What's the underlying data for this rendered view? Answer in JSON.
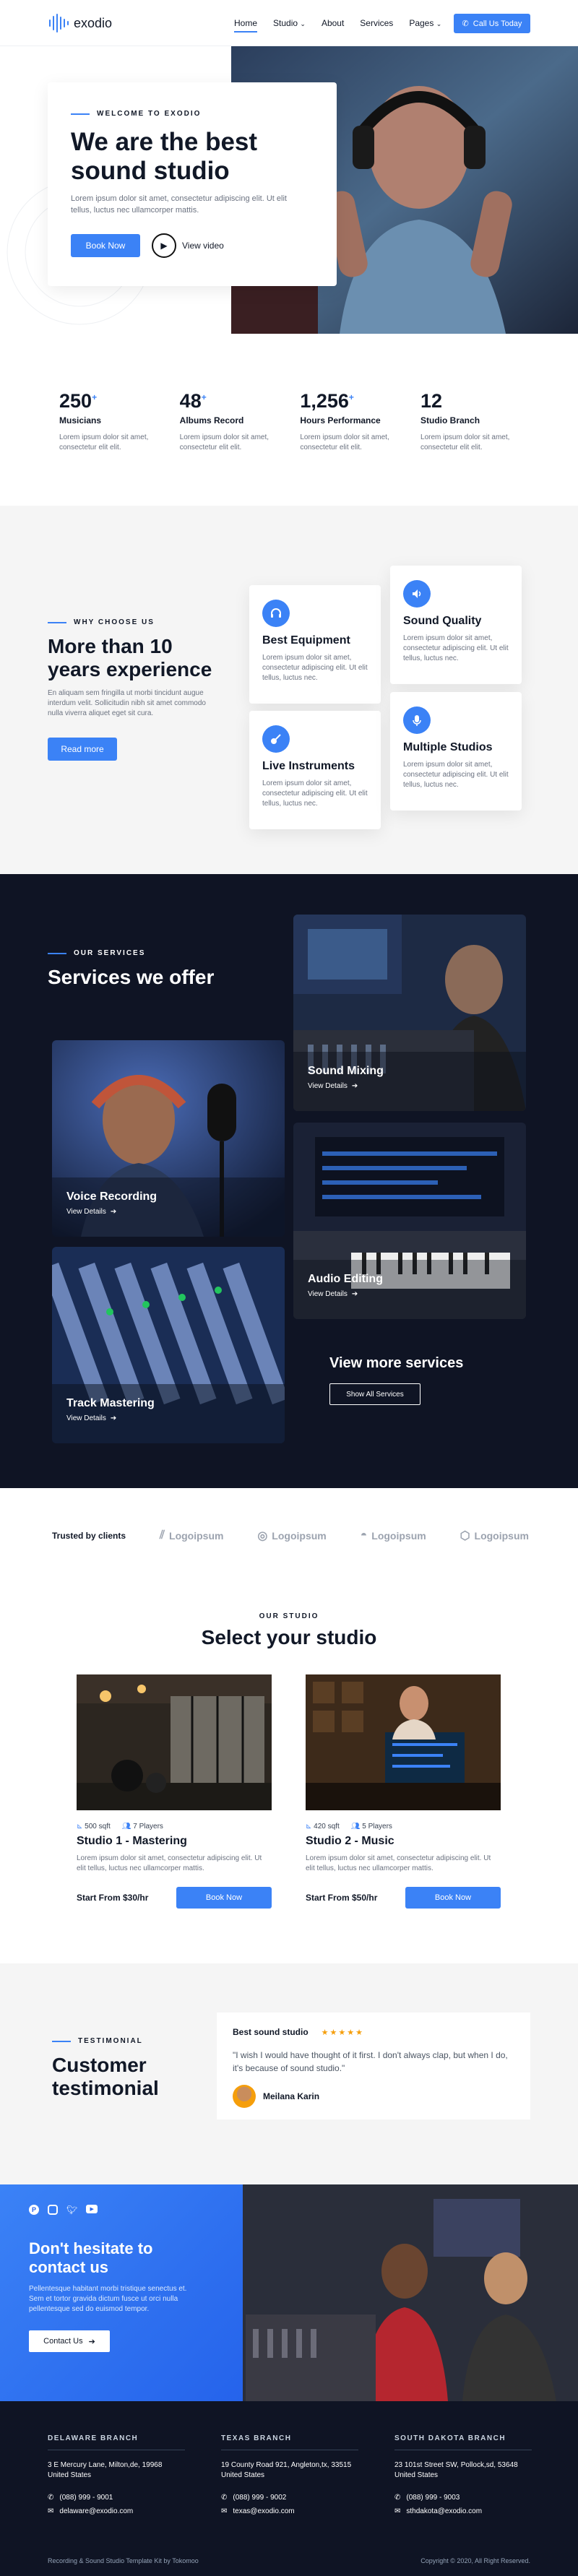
{
  "header": {
    "logo_text": "exodio",
    "nav": [
      "Home",
      "Studio",
      "About",
      "Services",
      "Pages"
    ],
    "cta": "Call Us Today"
  },
  "hero": {
    "eyebrow": "WELCOME TO EXODIO",
    "title_line1": "We are the best",
    "title_line2": "sound studio",
    "text": "Lorem ipsum dolor sit amet, consectetur adipiscing elit. Ut elit tellus, luctus nec ullamcorper mattis.",
    "primary_btn": "Book Now",
    "video_label": "View video"
  },
  "stats": [
    {
      "value": "250",
      "suffix": "+",
      "label": "Musicians",
      "text": "Lorem ipsum dolor sit amet, consectetur elit elit."
    },
    {
      "value": "48",
      "suffix": "+",
      "label": "Albums Record",
      "text": "Lorem ipsum dolor sit amet, consectetur elit elit."
    },
    {
      "value": "1,256",
      "suffix": "+",
      "label": "Hours Performance",
      "text": "Lorem ipsum dolor sit amet, consectetur elit elit."
    },
    {
      "value": "12",
      "suffix": "",
      "label": "Studio Branch",
      "text": "Lorem ipsum dolor sit amet, consectetur elit elit."
    }
  ],
  "why": {
    "eyebrow": "WHY CHOOSE US",
    "title_line1": "More than 10",
    "title_line2": "years experience",
    "text": "En aliquam sem fringilla ut morbi tincidunt augue interdum velit. Sollicitudin nibh sit amet commodo nulla viverra aliquet eget sit cura.",
    "btn": "Read more",
    "features": [
      {
        "title": "Best Equipment",
        "text": "Lorem ipsum dolor sit amet, consectetur adipiscing elit. Ut elit tellus, luctus nec.",
        "icon": "headphones-icon"
      },
      {
        "title": "Sound Quality",
        "text": "Lorem ipsum dolor sit amet, consectetur adipiscing elit. Ut elit tellus, luctus nec.",
        "icon": "speaker-icon"
      },
      {
        "title": "Live Instruments",
        "text": "Lorem ipsum dolor sit amet, consectetur adipiscing elit. Ut elit tellus, luctus nec.",
        "icon": "guitar-icon"
      },
      {
        "title": "Multiple Studios",
        "text": "Lorem ipsum dolor sit amet, consectetur adipiscing elit. Ut elit tellus, luctus nec.",
        "icon": "mic-icon"
      }
    ]
  },
  "services": {
    "eyebrow": "OUR SERVICES",
    "title": "Services we offer",
    "items": [
      {
        "title": "Sound Mixing",
        "link": "View Details"
      },
      {
        "title": "Voice Recording",
        "link": "View Details"
      },
      {
        "title": "Audio Editing",
        "link": "View Details"
      },
      {
        "title": "Track Mastering",
        "link": "View Details"
      }
    ],
    "more_title": "View more services",
    "more_btn": "Show All Services"
  },
  "clients": {
    "label": "Trusted by clients",
    "logos": [
      "Logoipsum",
      "Logoipsum",
      "Logoipsum",
      "Logoipsum"
    ]
  },
  "studio": {
    "eyebrow": "OUR STUDIO",
    "title": "Select your studio",
    "items": [
      {
        "size": "500 sqft",
        "players": "7 Players",
        "name": "Studio 1 - Mastering",
        "text": "Lorem ipsum dolor sit amet, consectetur adipiscing elit. Ut elit tellus, luctus nec ullamcorper mattis.",
        "price": "Start From $30/hr",
        "btn": "Book Now"
      },
      {
        "size": "420 sqft",
        "players": "5 Players",
        "name": "Studio 2 - Music",
        "text": "Lorem ipsum dolor sit amet, consectetur adipiscing elit. Ut elit tellus, luctus nec ullamcorper mattis.",
        "price": "Start From $50/hr",
        "btn": "Book Now"
      }
    ]
  },
  "testimonial": {
    "eyebrow": "TESTIMONIAL",
    "title_line1": "Customer",
    "title_line2": "testimonial",
    "heading": "Best sound studio",
    "stars": "★★★★★",
    "quote": "\"I wish I would have thought of it first. I don't always clap, but when I do, it's because of sound studio.\"",
    "author": "Meilana Karin"
  },
  "contact": {
    "title_line1": "Don't hesitate to",
    "title_line2": "contact us",
    "text": "Pellentesque habitant morbi tristique senectus et. Sem et tortor gravida dictum fusce ut orci nulla pellentesque sed do euismod tempor.",
    "btn": "Contact Us"
  },
  "footer": {
    "branches": [
      {
        "name": "DELAWARE BRANCH",
        "address": "3 E Mercury Lane, Milton,de, 19968 United States",
        "phone": "(088) 999 - 9001",
        "email": "delaware@exodio.com"
      },
      {
        "name": "TEXAS BRANCH",
        "address": "19 County Road 921, Angleton,tx, 33515 United States",
        "phone": "(088) 999 - 9002",
        "email": "texas@exodio.com"
      },
      {
        "name": "SOUTH DAKOTA BRANCH",
        "address": "23 101st Street SW, Pollock,sd, 53648 United States",
        "phone": "(088) 999 - 9003",
        "email": "sthdakota@exodio.com"
      }
    ],
    "credit": "Recording & Sound Studio Template Kit by Tokomoo",
    "copyright": "Copyright © 2020, All Right Reserved."
  },
  "colors": {
    "accent": "#3b82f6",
    "dark": "#0f1424",
    "light_bg": "#f5f5f5"
  }
}
